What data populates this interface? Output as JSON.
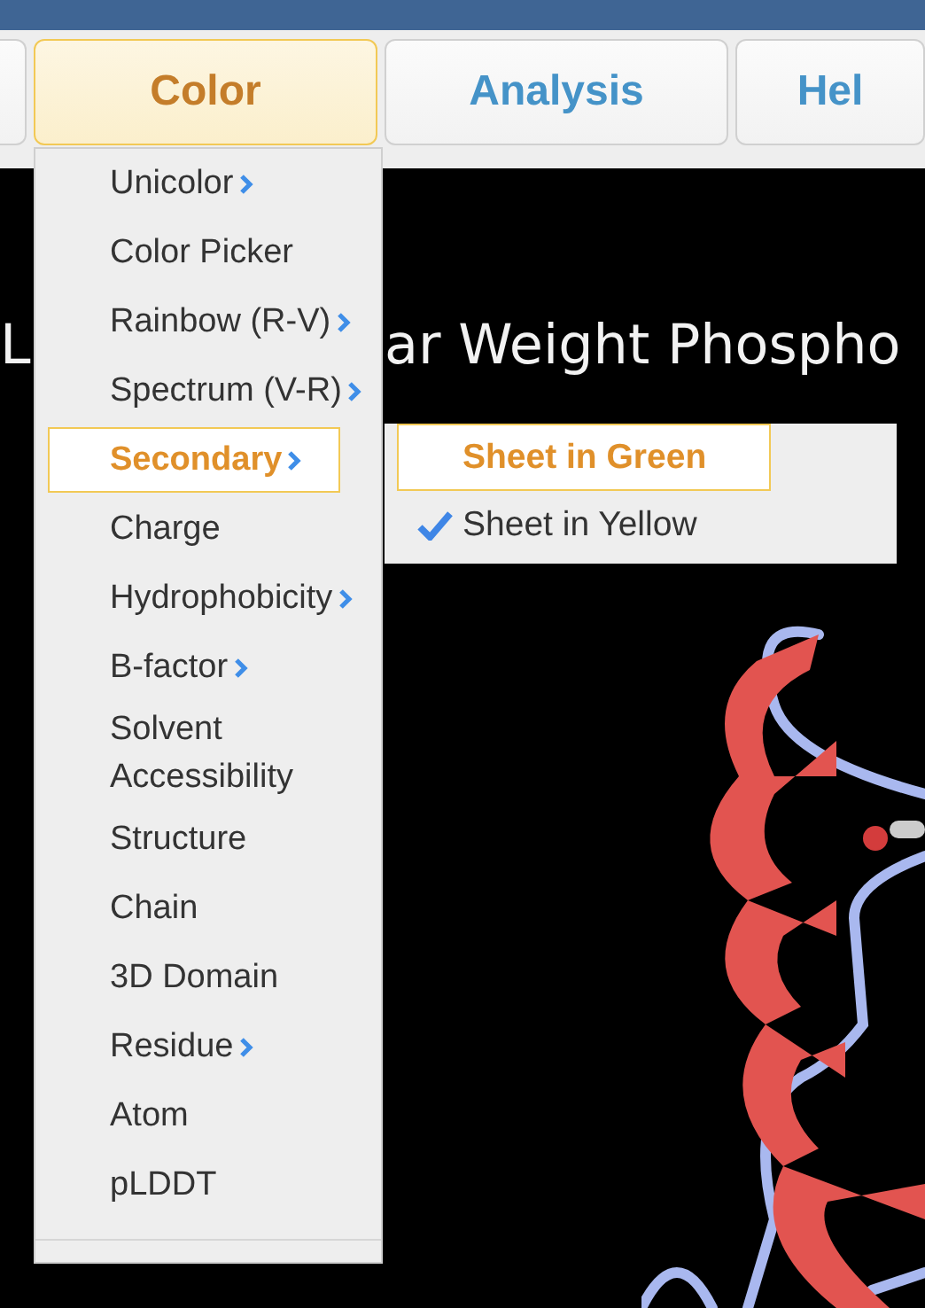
{
  "tabs": [
    {
      "label": "Color",
      "selected": true
    },
    {
      "label": "Analysis",
      "selected": false
    },
    {
      "label": "Hel",
      "selected": false
    }
  ],
  "viewer": {
    "title_fragments": [
      "L",
      "ar Weight Phospho"
    ]
  },
  "color_menu": {
    "items": [
      {
        "label": "Unicolor",
        "submenu": true,
        "selected": false
      },
      {
        "label": "Color Picker",
        "submenu": false,
        "selected": false
      },
      {
        "label": "Rainbow (R-V)",
        "submenu": true,
        "selected": false
      },
      {
        "label": "Spectrum (V-R)",
        "submenu": true,
        "selected": false
      },
      {
        "label": "Secondary",
        "submenu": true,
        "selected": true
      },
      {
        "label": "Charge",
        "submenu": false,
        "selected": false
      },
      {
        "label": "Hydrophobicity",
        "submenu": true,
        "selected": false
      },
      {
        "label": "B-factor",
        "submenu": true,
        "selected": false
      },
      {
        "label": "Solvent Accessibility",
        "submenu": false,
        "selected": false
      },
      {
        "label": "Structure",
        "submenu": false,
        "selected": false
      },
      {
        "label": "Chain",
        "submenu": false,
        "selected": false
      },
      {
        "label": "3D Domain",
        "submenu": false,
        "selected": false
      },
      {
        "label": "Residue",
        "submenu": true,
        "selected": false
      },
      {
        "label": "Atom",
        "submenu": false,
        "selected": false
      },
      {
        "label": "pLDDT",
        "submenu": false,
        "selected": false
      }
    ]
  },
  "secondary_submenu": {
    "items": [
      {
        "label": "Sheet in Green",
        "selected": true,
        "checked": false
      },
      {
        "label": "Sheet in Yellow",
        "selected": false,
        "checked": true
      }
    ]
  }
}
